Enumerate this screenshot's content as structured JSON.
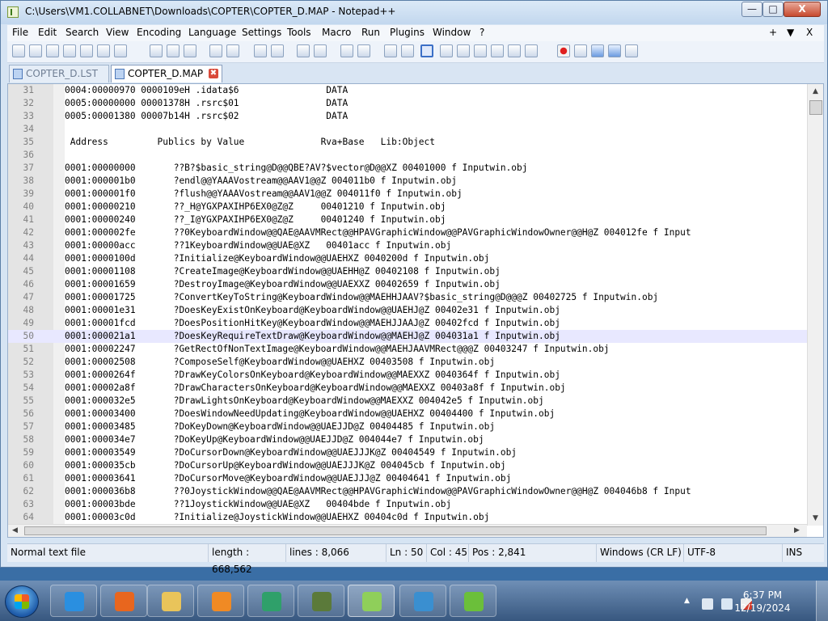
{
  "window": {
    "title": "C:\\Users\\VM1.COLLABNET\\Downloads\\COPTER\\COPTER_D.MAP - Notepad++",
    "minimize_glyph": "—",
    "maximize_glyph": "□",
    "close_glyph": "X"
  },
  "menu": {
    "items": [
      "File",
      "Edit",
      "Search",
      "View",
      "Encoding",
      "Language",
      "Settings",
      "Tools",
      "Macro",
      "Run",
      "Plugins",
      "Window",
      "?"
    ],
    "right_add": "+",
    "right_dropdown": "▼",
    "right_close": "X"
  },
  "tabs": [
    {
      "label": "COPTER_D.LST",
      "active": false
    },
    {
      "label": "COPTER_D.MAP",
      "active": true,
      "close_glyph": "✖"
    }
  ],
  "editor": {
    "lines": [
      {
        "n": "31",
        "text": "0004:00000970 0000109eH .idata$6                DATA"
      },
      {
        "n": "32",
        "text": "0005:00000000 00001378H .rsrc$01                DATA"
      },
      {
        "n": "33",
        "text": "0005:00001380 00007b14H .rsrc$02                DATA"
      },
      {
        "n": "34",
        "text": ""
      },
      {
        "n": "35",
        "text": " Address         Publics by Value              Rva+Base   Lib:Object"
      },
      {
        "n": "36",
        "text": ""
      },
      {
        "n": "37",
        "text": "0001:00000000       ??B?$basic_string@D@@QBE?AV?$vector@D@@XZ 00401000 f Inputwin.obj"
      },
      {
        "n": "38",
        "text": "0001:000001b0       ?endl@@YAAAVostream@@AAV1@@Z 004011b0 f Inputwin.obj"
      },
      {
        "n": "39",
        "text": "0001:000001f0       ?flush@@YAAAVostream@@AAV1@@Z 004011f0 f Inputwin.obj"
      },
      {
        "n": "40",
        "text": "0001:00000210       ??_H@YGXPAXIHP6EX0@Z@Z     00401210 f Inputwin.obj"
      },
      {
        "n": "41",
        "text": "0001:00000240       ??_I@YGXPAXIHP6EX0@Z@Z     00401240 f Inputwin.obj"
      },
      {
        "n": "42",
        "text": "0001:000002fe       ??0KeyboardWindow@@QAE@AAVMRect@@HPAVGraphicWindow@@PAVGraphicWindowOwner@@H@Z 004012fe f Input"
      },
      {
        "n": "43",
        "text": "0001:00000acc       ??1KeyboardWindow@@UAE@XZ   00401acc f Inputwin.obj"
      },
      {
        "n": "44",
        "text": "0001:0000100d       ?Initialize@KeyboardWindow@@UAEHXZ 0040200d f Inputwin.obj"
      },
      {
        "n": "45",
        "text": "0001:00001108       ?CreateImage@KeyboardWindow@@UAEHH@Z 00402108 f Inputwin.obj"
      },
      {
        "n": "46",
        "text": "0001:00001659       ?DestroyImage@KeyboardWindow@@UAEXXZ 00402659 f Inputwin.obj"
      },
      {
        "n": "47",
        "text": "0001:00001725       ?ConvertKeyToString@KeyboardWindow@@MAEHHJAAV?$basic_string@D@@@Z 00402725 f Inputwin.obj"
      },
      {
        "n": "48",
        "text": "0001:00001e31       ?DoesKeyExistOnKeyboard@KeyboardWindow@@UAEHJ@Z 00402e31 f Inputwin.obj"
      },
      {
        "n": "49",
        "text": "0001:00001fcd       ?DoesPositionHitKey@KeyboardWindow@@MAEHJJAAJ@Z 00402fcd f Inputwin.obj"
      },
      {
        "n": "50",
        "text": "0001:000021a1       ?DoesKeyRequireTextDraw@KeyboardWindow@@MAEHJ@Z 004031a1 f Inputwin.obj"
      },
      {
        "n": "51",
        "text": "0001:00002247       ?GetRectOfNonTextImage@KeyboardWindow@@MAEHJAAVMRect@@@Z 00403247 f Inputwin.obj"
      },
      {
        "n": "52",
        "text": "0001:00002508       ?ComposeSelf@KeyboardWindow@@UAEHXZ 00403508 f Inputwin.obj"
      },
      {
        "n": "53",
        "text": "0001:0000264f       ?DrawKeyColorsOnKeyboard@KeyboardWindow@@MAEXXZ 0040364f f Inputwin.obj"
      },
      {
        "n": "54",
        "text": "0001:00002a8f       ?DrawCharactersOnKeyboard@KeyboardWindow@@MAEXXZ 00403a8f f Inputwin.obj"
      },
      {
        "n": "55",
        "text": "0001:000032e5       ?DrawLightsOnKeyboard@KeyboardWindow@@MAEXXZ 004042e5 f Inputwin.obj"
      },
      {
        "n": "56",
        "text": "0001:00003400       ?DoesWindowNeedUpdating@KeyboardWindow@@UAEHXZ 00404400 f Inputwin.obj"
      },
      {
        "n": "57",
        "text": "0001:00003485       ?DoKeyDown@KeyboardWindow@@UAEJJD@Z 00404485 f Inputwin.obj"
      },
      {
        "n": "58",
        "text": "0001:000034e7       ?DoKeyUp@KeyboardWindow@@UAEJJD@Z 004044e7 f Inputwin.obj"
      },
      {
        "n": "59",
        "text": "0001:00003549       ?DoCursorDown@KeyboardWindow@@UAEJJJK@Z 00404549 f Inputwin.obj"
      },
      {
        "n": "60",
        "text": "0001:000035cb       ?DoCursorUp@KeyboardWindow@@UAEJJJK@Z 004045cb f Inputwin.obj"
      },
      {
        "n": "61",
        "text": "0001:00003641       ?DoCursorMove@KeyboardWindow@@UAEJJJ@Z 00404641 f Inputwin.obj"
      },
      {
        "n": "62",
        "text": "0001:000036b8       ??0JoystickWindow@@QAE@AAVMRect@@HPAVGraphicWindow@@PAVGraphicWindowOwner@@H@Z 004046b8 f Input"
      },
      {
        "n": "63",
        "text": "0001:00003bde       ??1JoystickWindow@@UAE@XZ   00404bde f Inputwin.obj"
      },
      {
        "n": "64",
        "text": "0001:00003c0d       ?Initialize@JoystickWindow@@UAEHXZ 00404c0d f Inputwin.obj"
      }
    ],
    "current_line": "50"
  },
  "status": {
    "file_type": "Normal text file",
    "length": "length : 668,562",
    "lines": "lines : 8,066",
    "ln": "Ln : 50",
    "col": "Col : 45",
    "pos": "Pos : 2,841",
    "eol": "Windows (CR LF)",
    "encoding": "UTF-8",
    "mode": "INS"
  },
  "taskbar": {
    "time": "6:37 PM",
    "date": "12/19/2024",
    "tray_arrow": "▲",
    "apps": [
      {
        "name": "internet-explorer",
        "color": "#2a8fe0"
      },
      {
        "name": "firefox",
        "color": "#e8661e"
      },
      {
        "name": "file-explorer",
        "color": "#e9c45a"
      },
      {
        "name": "media-player",
        "color": "#f08a24"
      },
      {
        "name": "app-green-circle",
        "color": "#2fa06a"
      },
      {
        "name": "network-tool",
        "color": "#5b7a3a"
      },
      {
        "name": "notepad-plus-plus",
        "color": "#8fcf5a"
      },
      {
        "name": "app-t-circle",
        "color": "#3a8fd0"
      },
      {
        "name": "frog-app",
        "color": "#6bbf3a"
      }
    ],
    "colors": {
      "tray_monitor": "#dfe8f2",
      "tray_flag": "#d9e6f3",
      "tray_volume": "#eeeeee",
      "tray_red": "#d23b2b"
    }
  }
}
